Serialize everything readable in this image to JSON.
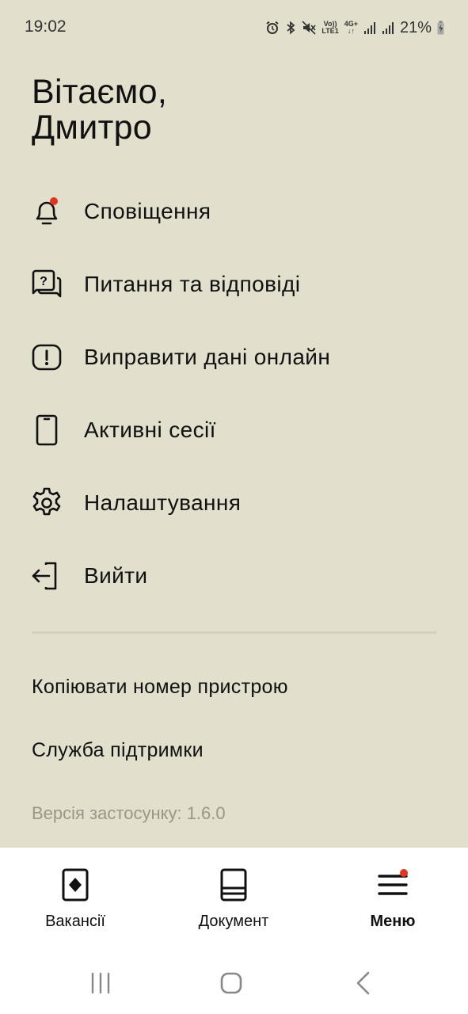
{
  "status_bar": {
    "time": "19:02",
    "volte_top": "Vo))",
    "volte_bottom": "LTE1",
    "network_top": "4G+",
    "battery": "21%"
  },
  "greeting": {
    "line1": "Вітаємо,",
    "line2": "Дмитро"
  },
  "menu": {
    "items": [
      {
        "label": "Сповіщення",
        "icon": "bell-icon",
        "has_dot": true
      },
      {
        "label": "Питання та відповіді",
        "icon": "question-chat-icon"
      },
      {
        "label": "Виправити дані онлайн",
        "icon": "exclamation-icon"
      },
      {
        "label": "Активні сесії",
        "icon": "phone-icon"
      },
      {
        "label": "Налаштування",
        "icon": "gear-icon"
      },
      {
        "label": "Вийти",
        "icon": "logout-icon"
      }
    ]
  },
  "links": {
    "copy_device": "Копіювати номер пристрою",
    "support": "Служба підтримки"
  },
  "version": "Версія застосунку: 1.6.0",
  "tabbar": {
    "vacancies": "Вакансії",
    "document": "Документ",
    "menu": "Меню",
    "active": "menu"
  },
  "colors": {
    "background": "#e2dfcc",
    "accent_dot": "#e2351d",
    "tabbar_bg": "#ffffff"
  }
}
